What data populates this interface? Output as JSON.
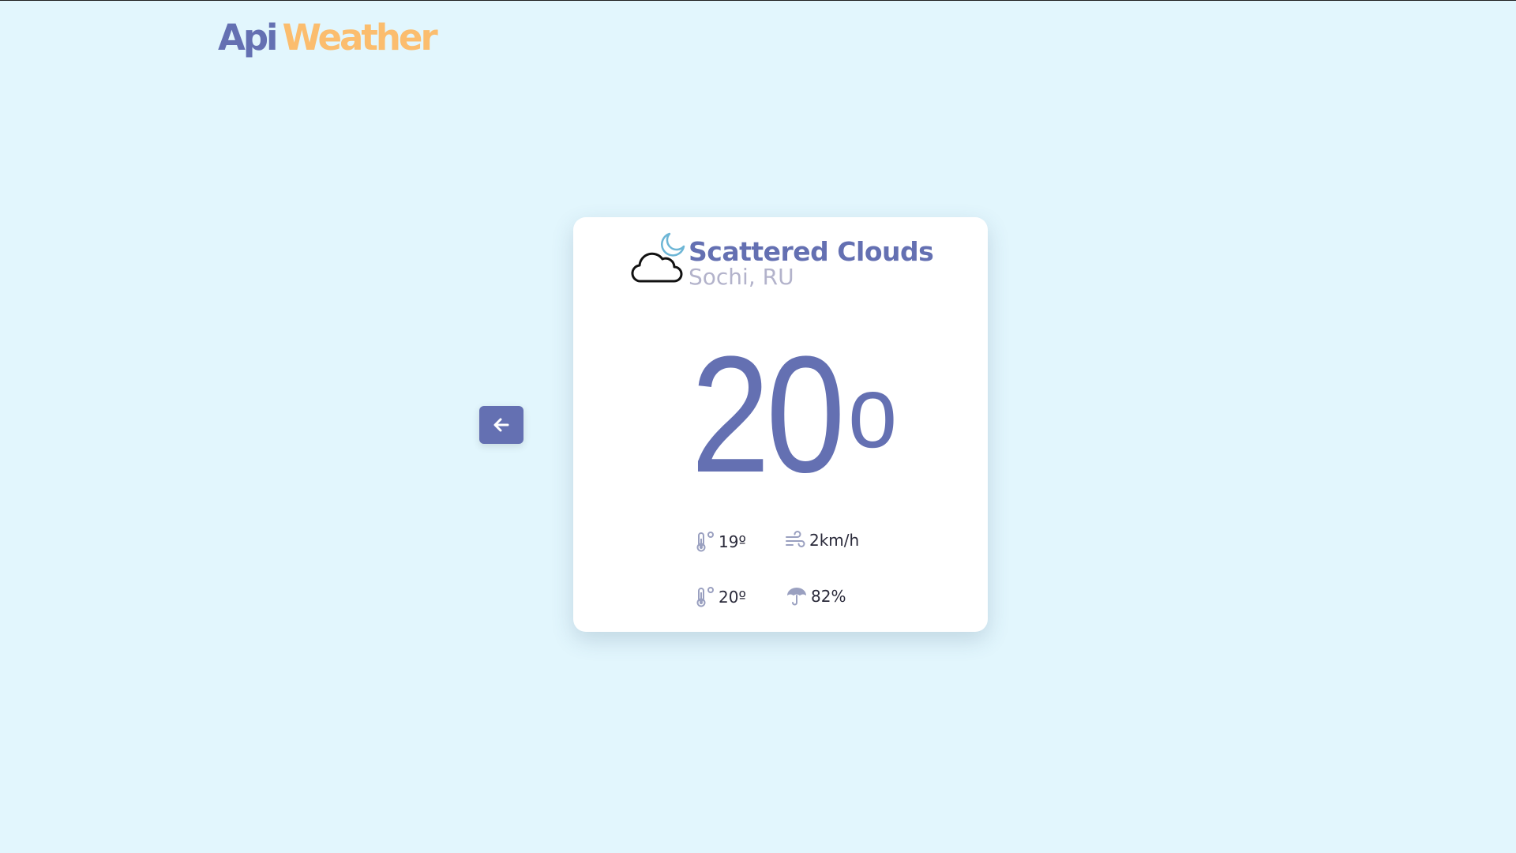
{
  "logo": {
    "part1": "Api",
    "part2": "Weather",
    "color1": "#6470b2",
    "color2": "#fbbd6e"
  },
  "nav": {
    "back_icon": "arrow-left-icon"
  },
  "weather": {
    "condition": "Scattered Clouds",
    "location": "Sochi, RU",
    "temperature": "20",
    "degree_mark": "o",
    "condition_icon": "cloud-moon-icon",
    "stats": {
      "temp_min": "19º",
      "wind": "2km/h",
      "temp_max": "20º",
      "humidity": "82%"
    }
  },
  "colors": {
    "background": "#e2f6fd",
    "accent": "#6470b2",
    "muted": "#b3b3cb"
  }
}
